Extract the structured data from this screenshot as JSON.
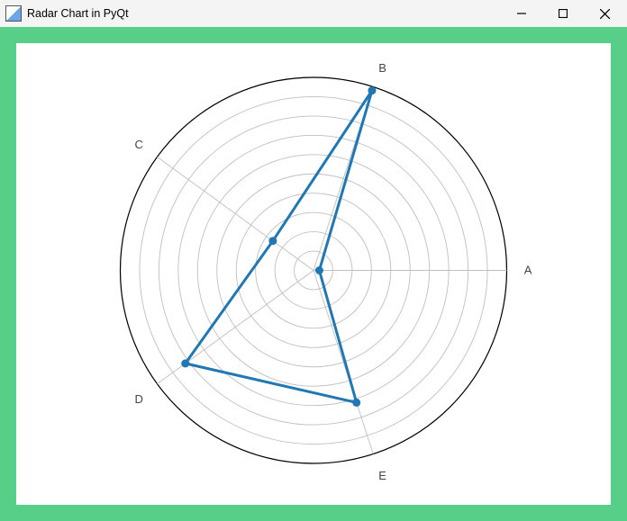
{
  "window": {
    "title": "Radar Chart in PyQt"
  },
  "chart_data": {
    "type": "radar",
    "categories": [
      "A",
      "B",
      "C",
      "D",
      "E"
    ],
    "values": [
      0.3,
      9.8,
      2.6,
      8.2,
      7.2
    ],
    "rlim": [
      0,
      10
    ],
    "rings": 10,
    "line_color": "#1f77b4",
    "marker": "o",
    "linewidth": 2
  }
}
